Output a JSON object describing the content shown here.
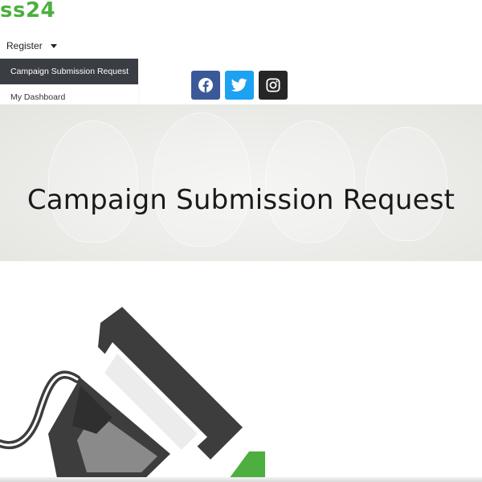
{
  "brand": {
    "logo_text": "ss24",
    "accent": "#4caf3f"
  },
  "nav": {
    "register_label": "Register",
    "dropdown": [
      {
        "label": "Campaign Submission Request",
        "active": true
      },
      {
        "label": "My Dashboard",
        "active": false
      }
    ]
  },
  "social": [
    {
      "icon": "facebook-icon",
      "color": "#3b5998"
    },
    {
      "icon": "twitter-icon",
      "color": "#1da1f2"
    },
    {
      "icon": "instagram-icon",
      "color": "#262626"
    }
  ],
  "hero": {
    "title": "Campaign Submission Request"
  }
}
